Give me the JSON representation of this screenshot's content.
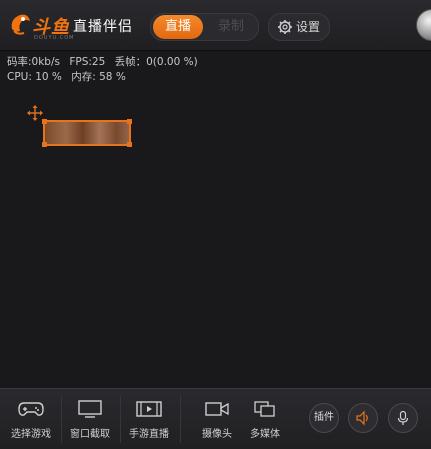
{
  "header": {
    "logo_text": "斗鱼",
    "logo_sub": "DOUYU.COM",
    "app_title": "直播伴侣",
    "mode_live": "直播",
    "mode_record": "录制",
    "settings_label": "设置",
    "accent_color": "#f0730f"
  },
  "stats": {
    "bitrate": "码率:0kb/s",
    "fps": "FPS:25",
    "dropped": "丢帧：0(0.00 %)",
    "cpu": "CPU: 10 %",
    "memory": "内存: 58 %"
  },
  "toolbar": {
    "select_game": "选择游戏",
    "window_capture": "窗口截取",
    "mobile_live": "手游直播",
    "camera": "摄像头",
    "multimedia": "多媒体",
    "plugins": "插件"
  },
  "icons": [
    "gamepad-icon",
    "monitor-icon",
    "play-screen-icon",
    "video-camera-icon",
    "media-icon",
    "speaker-icon",
    "microphone-icon",
    "gear-icon",
    "move-icon"
  ]
}
